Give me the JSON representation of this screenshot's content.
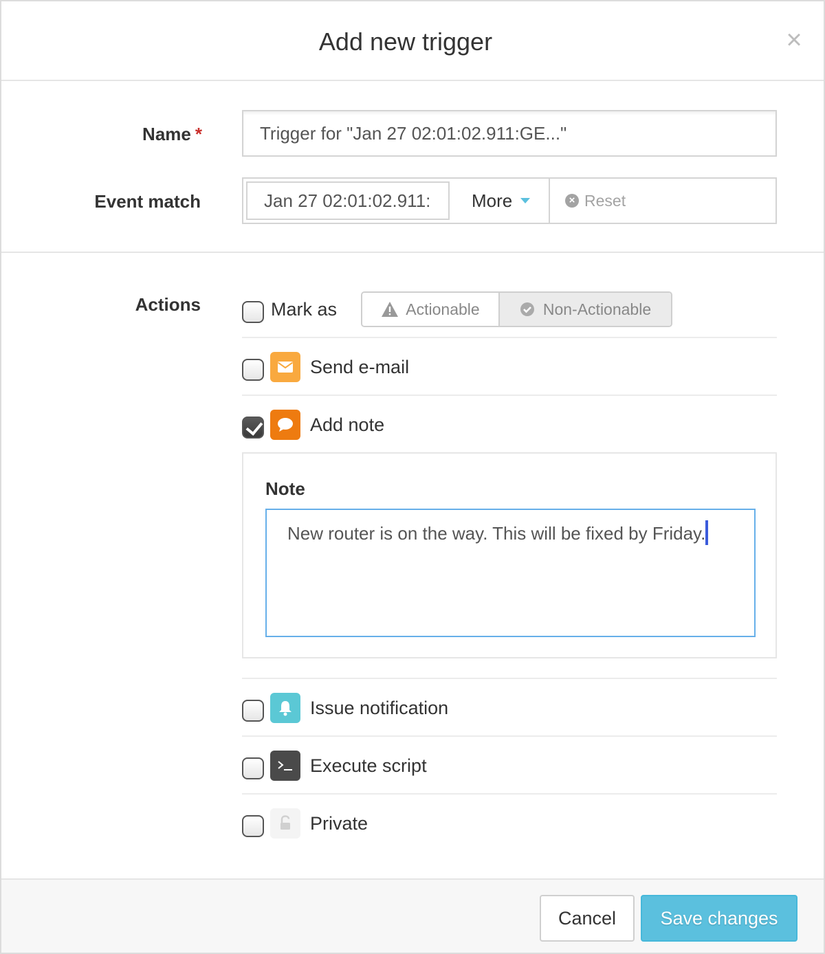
{
  "modal": {
    "title": "Add new trigger",
    "close_glyph": "×"
  },
  "form": {
    "name_label": "Name",
    "required_mark": "*",
    "name_value": "Trigger for \"Jan 27 02:01:02.911:GE...\"",
    "event_match_label": "Event match",
    "event_match_value": "Jan 27 02:01:02.911:",
    "more_label": "More",
    "reset_label": "Reset"
  },
  "actions": {
    "label": "Actions",
    "mark_as": {
      "label": "Mark as",
      "checked": false,
      "options": [
        "Actionable",
        "Non-Actionable"
      ],
      "selected": "Non-Actionable"
    },
    "send_email": {
      "label": "Send e-mail",
      "checked": false,
      "icon": "envelope-icon",
      "color": "#f9a93f"
    },
    "add_note": {
      "label": "Add note",
      "checked": true,
      "icon": "speech-bubble-icon",
      "color": "#ee7b10"
    },
    "issue_notification": {
      "label": "Issue notification",
      "checked": false,
      "icon": "bell-icon",
      "color": "#5bc8d5"
    },
    "execute_script": {
      "label": "Execute script",
      "checked": false,
      "icon": "terminal-icon",
      "color": "#4a4a4a"
    },
    "private": {
      "label": "Private",
      "checked": false,
      "icon": "unlock-icon",
      "color": "#f4f4f4"
    }
  },
  "note": {
    "label": "Note",
    "value": "New router is on the way. This will be fixed by Friday."
  },
  "footer": {
    "cancel_label": "Cancel",
    "save_label": "Save changes",
    "accent": "#5bc0de"
  }
}
